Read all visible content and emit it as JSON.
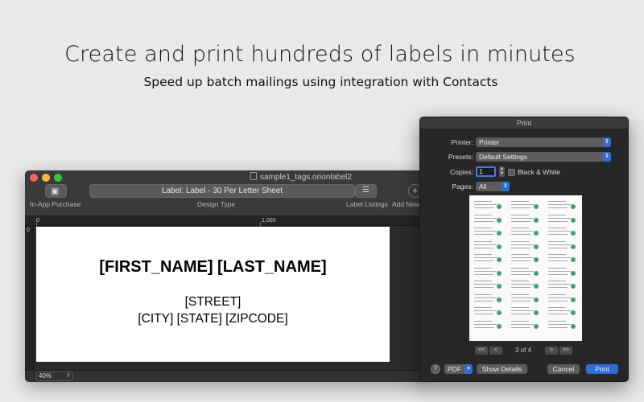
{
  "marketing": {
    "headline": "Create and print hundreds of labels in minutes",
    "subheadline": "Speed up batch mailings using integration with Contacts"
  },
  "main_window": {
    "document_title": "sample1_tags.orionlabel2",
    "toolbar": {
      "in_app_purchase_label": "In-App Purchase",
      "design_type_value": "Label: Label - 30 Per Letter Sheet",
      "design_type_label": "Design Type",
      "label_listings_label": "Label Listings",
      "add_new_label": "Add New"
    },
    "ruler": {
      "top_start": "0",
      "top_mark": "1,000",
      "left_start": "0"
    },
    "label_canvas": {
      "name_line": "[FIRST_NAME] [LAST_NAME]",
      "street_line": "[STREET]",
      "city_line": "[CITY] [STATE] [ZIPCODE]"
    },
    "zoom": "40%"
  },
  "print_dialog": {
    "title": "Print",
    "printer": {
      "label": "Printer:",
      "value": "Printer"
    },
    "presets": {
      "label": "Presets:",
      "value": "Default Settings"
    },
    "copies": {
      "label": "Copies:",
      "value": "1"
    },
    "black_white": {
      "label": "Black & White",
      "checked": false
    },
    "pages": {
      "label": "Pages:",
      "value": "All"
    },
    "preview": {
      "rows": 10,
      "columns": 3
    },
    "pager": {
      "first": "<<",
      "prev": "<",
      "text": "3 of 4",
      "next": ">",
      "last": ">>"
    },
    "help": "?",
    "pdf_button": "PDF",
    "show_details_button": "Show Details",
    "cancel_button": "Cancel",
    "print_button": "Print"
  },
  "colors": {
    "background": "#e9e9e9",
    "window": "#2b2b2b",
    "accent_blue": "#2f6ed9",
    "contact_icon_green": "#3ea36a"
  }
}
